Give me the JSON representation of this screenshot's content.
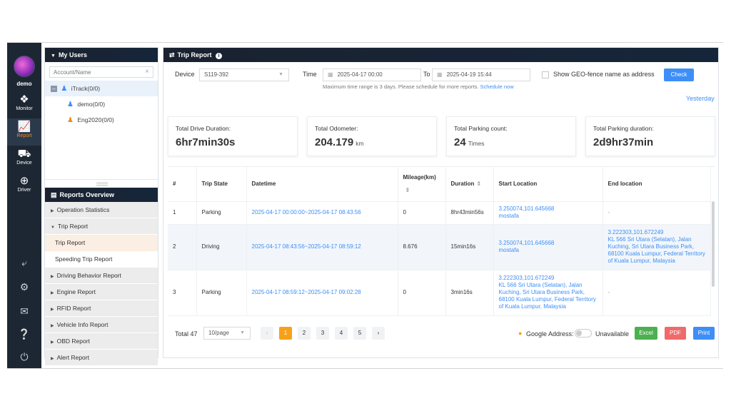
{
  "user": {
    "name": "demo"
  },
  "nav": {
    "monitor": "Monitor",
    "report": "Report",
    "device": "Device",
    "driver": "Driver"
  },
  "my_users": {
    "title": "My Users",
    "search_placeholder": "Account/Name",
    "tree": [
      "iTrack(0/0)",
      "demo(0/0)",
      "Eng2020(0/0)"
    ]
  },
  "reports_overview": {
    "title": "Reports Overview",
    "items": [
      "Operation Statistics",
      "Trip Report",
      "Trip Report",
      "Speeding Trip Report",
      "Driving Behavior Report",
      "Engine Report",
      "RFID Report",
      "Vehicle Info Report",
      "OBD Report",
      "Alert Report"
    ]
  },
  "main": {
    "title": "Trip Report",
    "device_label": "Device",
    "device_value": "S119-392",
    "time_label": "Time",
    "time_from": "2025-04-17 00:00",
    "to_label": "To",
    "time_to": "2025-04-19 15:44",
    "geofence_label": "Show GEO-fence name as address",
    "check_label": "Check",
    "note": "Maximum time range is 3 days. Please schedule for more reports.",
    "schedule_link": "Schedule now",
    "yesterday": "Yesterday"
  },
  "stats": [
    {
      "title": "Total Drive Duration:",
      "value": "6hr7min30s",
      "unit": ""
    },
    {
      "title": "Total Odometer:",
      "value": "204.179",
      "unit": "km"
    },
    {
      "title": "Total Parking count:",
      "value": "24",
      "unit": "Times"
    },
    {
      "title": "Total Parking duration:",
      "value": "2d9hr37min",
      "unit": ""
    }
  ],
  "table": {
    "headers": [
      "#",
      "Trip State",
      "Datetime",
      "Mileage(km)",
      "Duration",
      "Start Location",
      "End location"
    ],
    "rows": [
      {
        "n": "1",
        "state": "Parking",
        "datetime": "2025-04-17 00:00:00~2025-04-17 08:43:56",
        "mileage": "0",
        "duration": "8hr43min56s",
        "start1": "3.250074,101.645668",
        "start2": "mostafa",
        "end": "-"
      },
      {
        "n": "2",
        "state": "Driving",
        "datetime": "2025-04-17 08:43:56~2025-04-17 08:59:12",
        "mileage": "8.676",
        "duration": "15min16s",
        "start1": "3.250074,101.645668",
        "start2": "mostafa",
        "end": "3.222303,101.672249\nKL 566 Sri Utara (Selatan), Jalan Kuching, Sri Utara Business Park, 68100 Kuala Lumpur, Federal Territory of Kuala Lumpur, Malaysia"
      },
      {
        "n": "3",
        "state": "Parking",
        "datetime": "2025-04-17 08:59:12~2025-04-17 09:02:28",
        "mileage": "0",
        "duration": "3min16s",
        "start1": "3.222303,101.672249",
        "start2": "KL 566 Sri Utara (Selatan), Jalan Kuching, Sri Utara Business Park, 68100 Kuala Lumpur, Federal Territory of Kuala Lumpur, Malaysia",
        "end": "-"
      }
    ]
  },
  "pager": {
    "total": "Total 47",
    "per_page": "10/page",
    "pages": [
      "1",
      "2",
      "3",
      "4",
      "5"
    ],
    "google_address": "Google Address:",
    "unavailable": "Unavailable",
    "excel": "Excel",
    "pdf": "PDF",
    "print": "Print"
  }
}
